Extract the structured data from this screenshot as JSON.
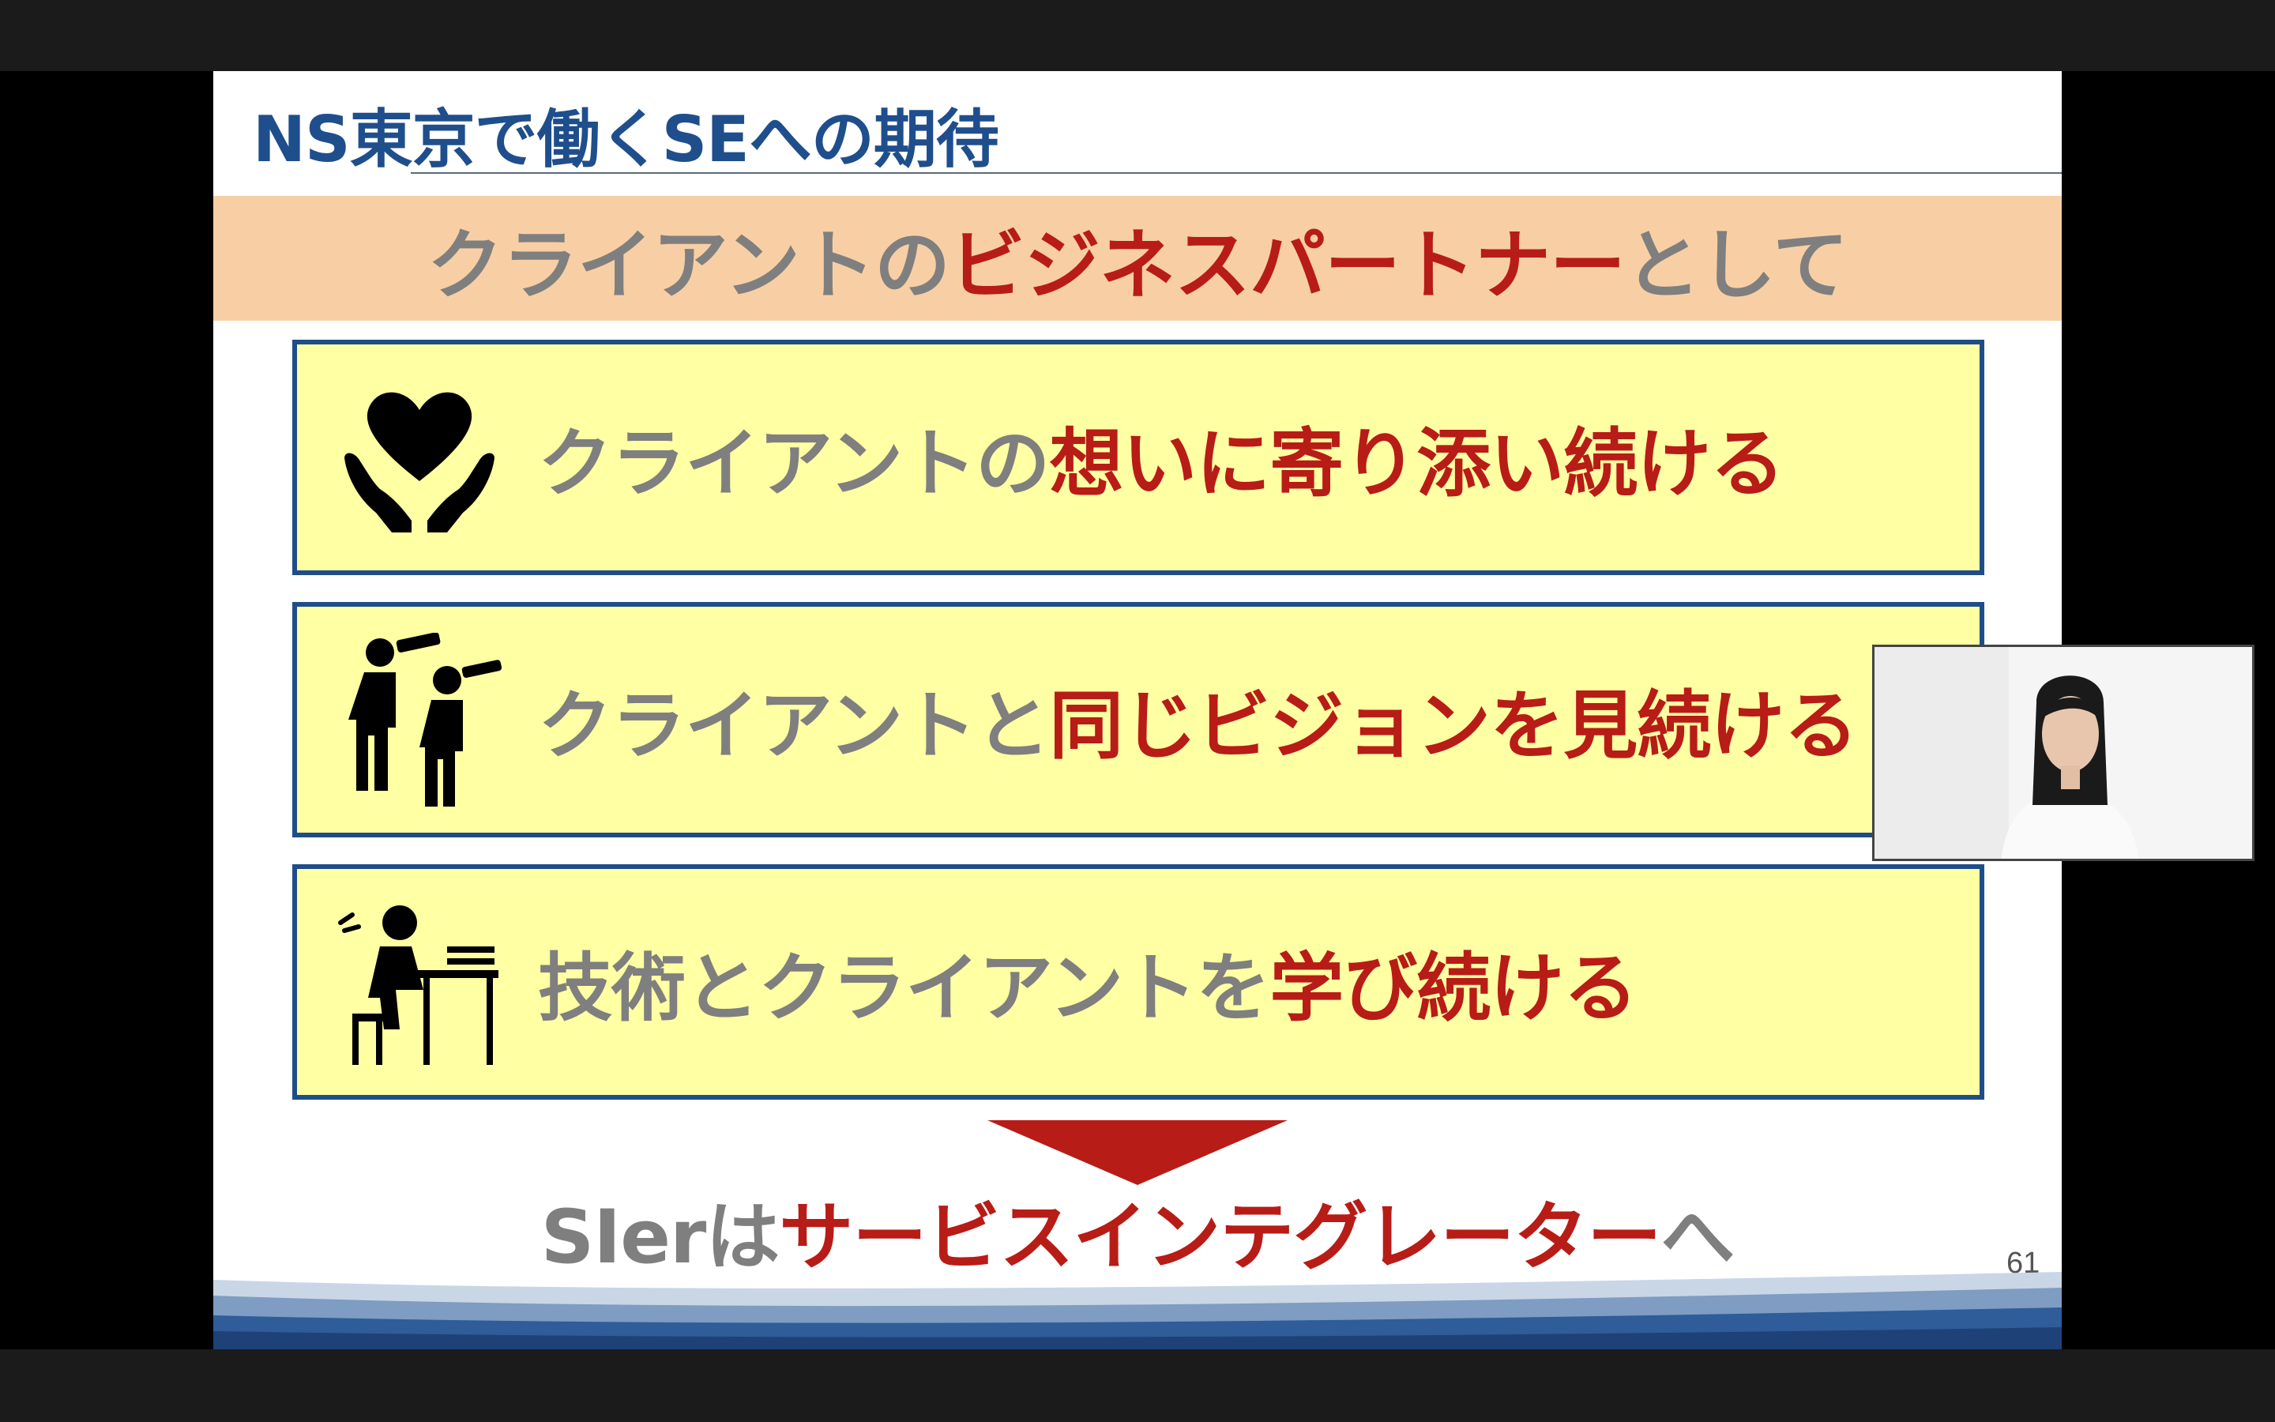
{
  "slide": {
    "title": "NS東京で働くSEへの期待",
    "banner": {
      "part1": "クライアントの",
      "part2": "ビジネスパートナー",
      "part3": "として"
    },
    "cards": [
      {
        "icon": "heart-hands-icon",
        "gray": "クライアントの",
        "red": "想いに寄り添い続ける"
      },
      {
        "icon": "people-telescope-icon",
        "gray": "クライアントと",
        "red": "同じビジョンを見続ける"
      },
      {
        "icon": "person-studying-icon",
        "gray": "技術とクライアントを",
        "red": "学び続ける"
      }
    ],
    "conclusion": {
      "part1": "SIerは",
      "part2": "サービスインテグレーター",
      "part3": "へ"
    },
    "page_number": "61"
  },
  "colors": {
    "title_blue": "#1f4e8c",
    "accent_red": "#b81c17",
    "text_gray": "#7f7f7f",
    "banner_bg": "#f8cfa4",
    "card_bg": "#ffffa3",
    "card_border": "#1e4d8a"
  }
}
